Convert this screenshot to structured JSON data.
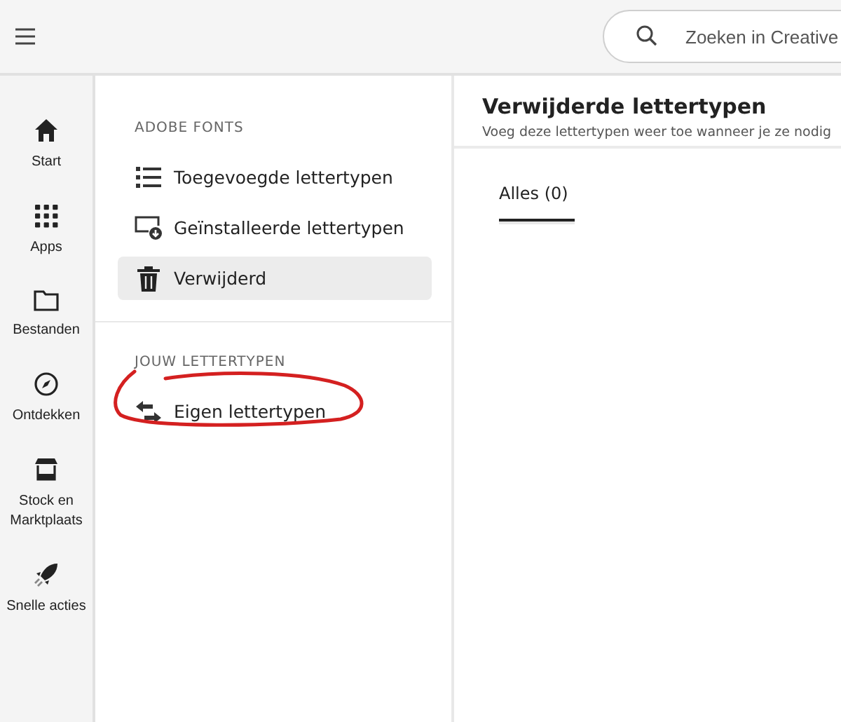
{
  "topbar": {
    "search": {
      "placeholder": "Zoeken in Creative"
    }
  },
  "rail": [
    {
      "kind": "home",
      "label": "Start"
    },
    {
      "kind": "apps",
      "label": "Apps"
    },
    {
      "kind": "folder",
      "label": "Bestanden"
    },
    {
      "kind": "compass",
      "label": "Ontdekken"
    },
    {
      "kind": "store",
      "label": "Stock en Marktplaats"
    },
    {
      "kind": "rocket",
      "label": "Snelle acties"
    }
  ],
  "sections": [
    {
      "heading": "ADOBE FONTS",
      "items": [
        {
          "kind": "list",
          "label": "Toegevoegde lettertypen",
          "selected": false
        },
        {
          "kind": "installed",
          "label": "Geïnstalleerde lettertypen",
          "selected": false
        },
        {
          "kind": "trash",
          "label": "Verwijderd",
          "selected": true
        }
      ]
    },
    {
      "heading": "JOUW LETTERTYPEN",
      "items": [
        {
          "kind": "swap",
          "label": "Eigen lettertypen",
          "selected": false
        }
      ]
    }
  ],
  "content": {
    "title": "Verwijderde lettertypen",
    "subtitle": "Voeg deze lettertypen weer toe wanneer je ze nodig",
    "tabs": [
      {
        "label": "Alles (0)",
        "selected": true
      }
    ]
  },
  "annotation": {
    "kind": "circle"
  }
}
